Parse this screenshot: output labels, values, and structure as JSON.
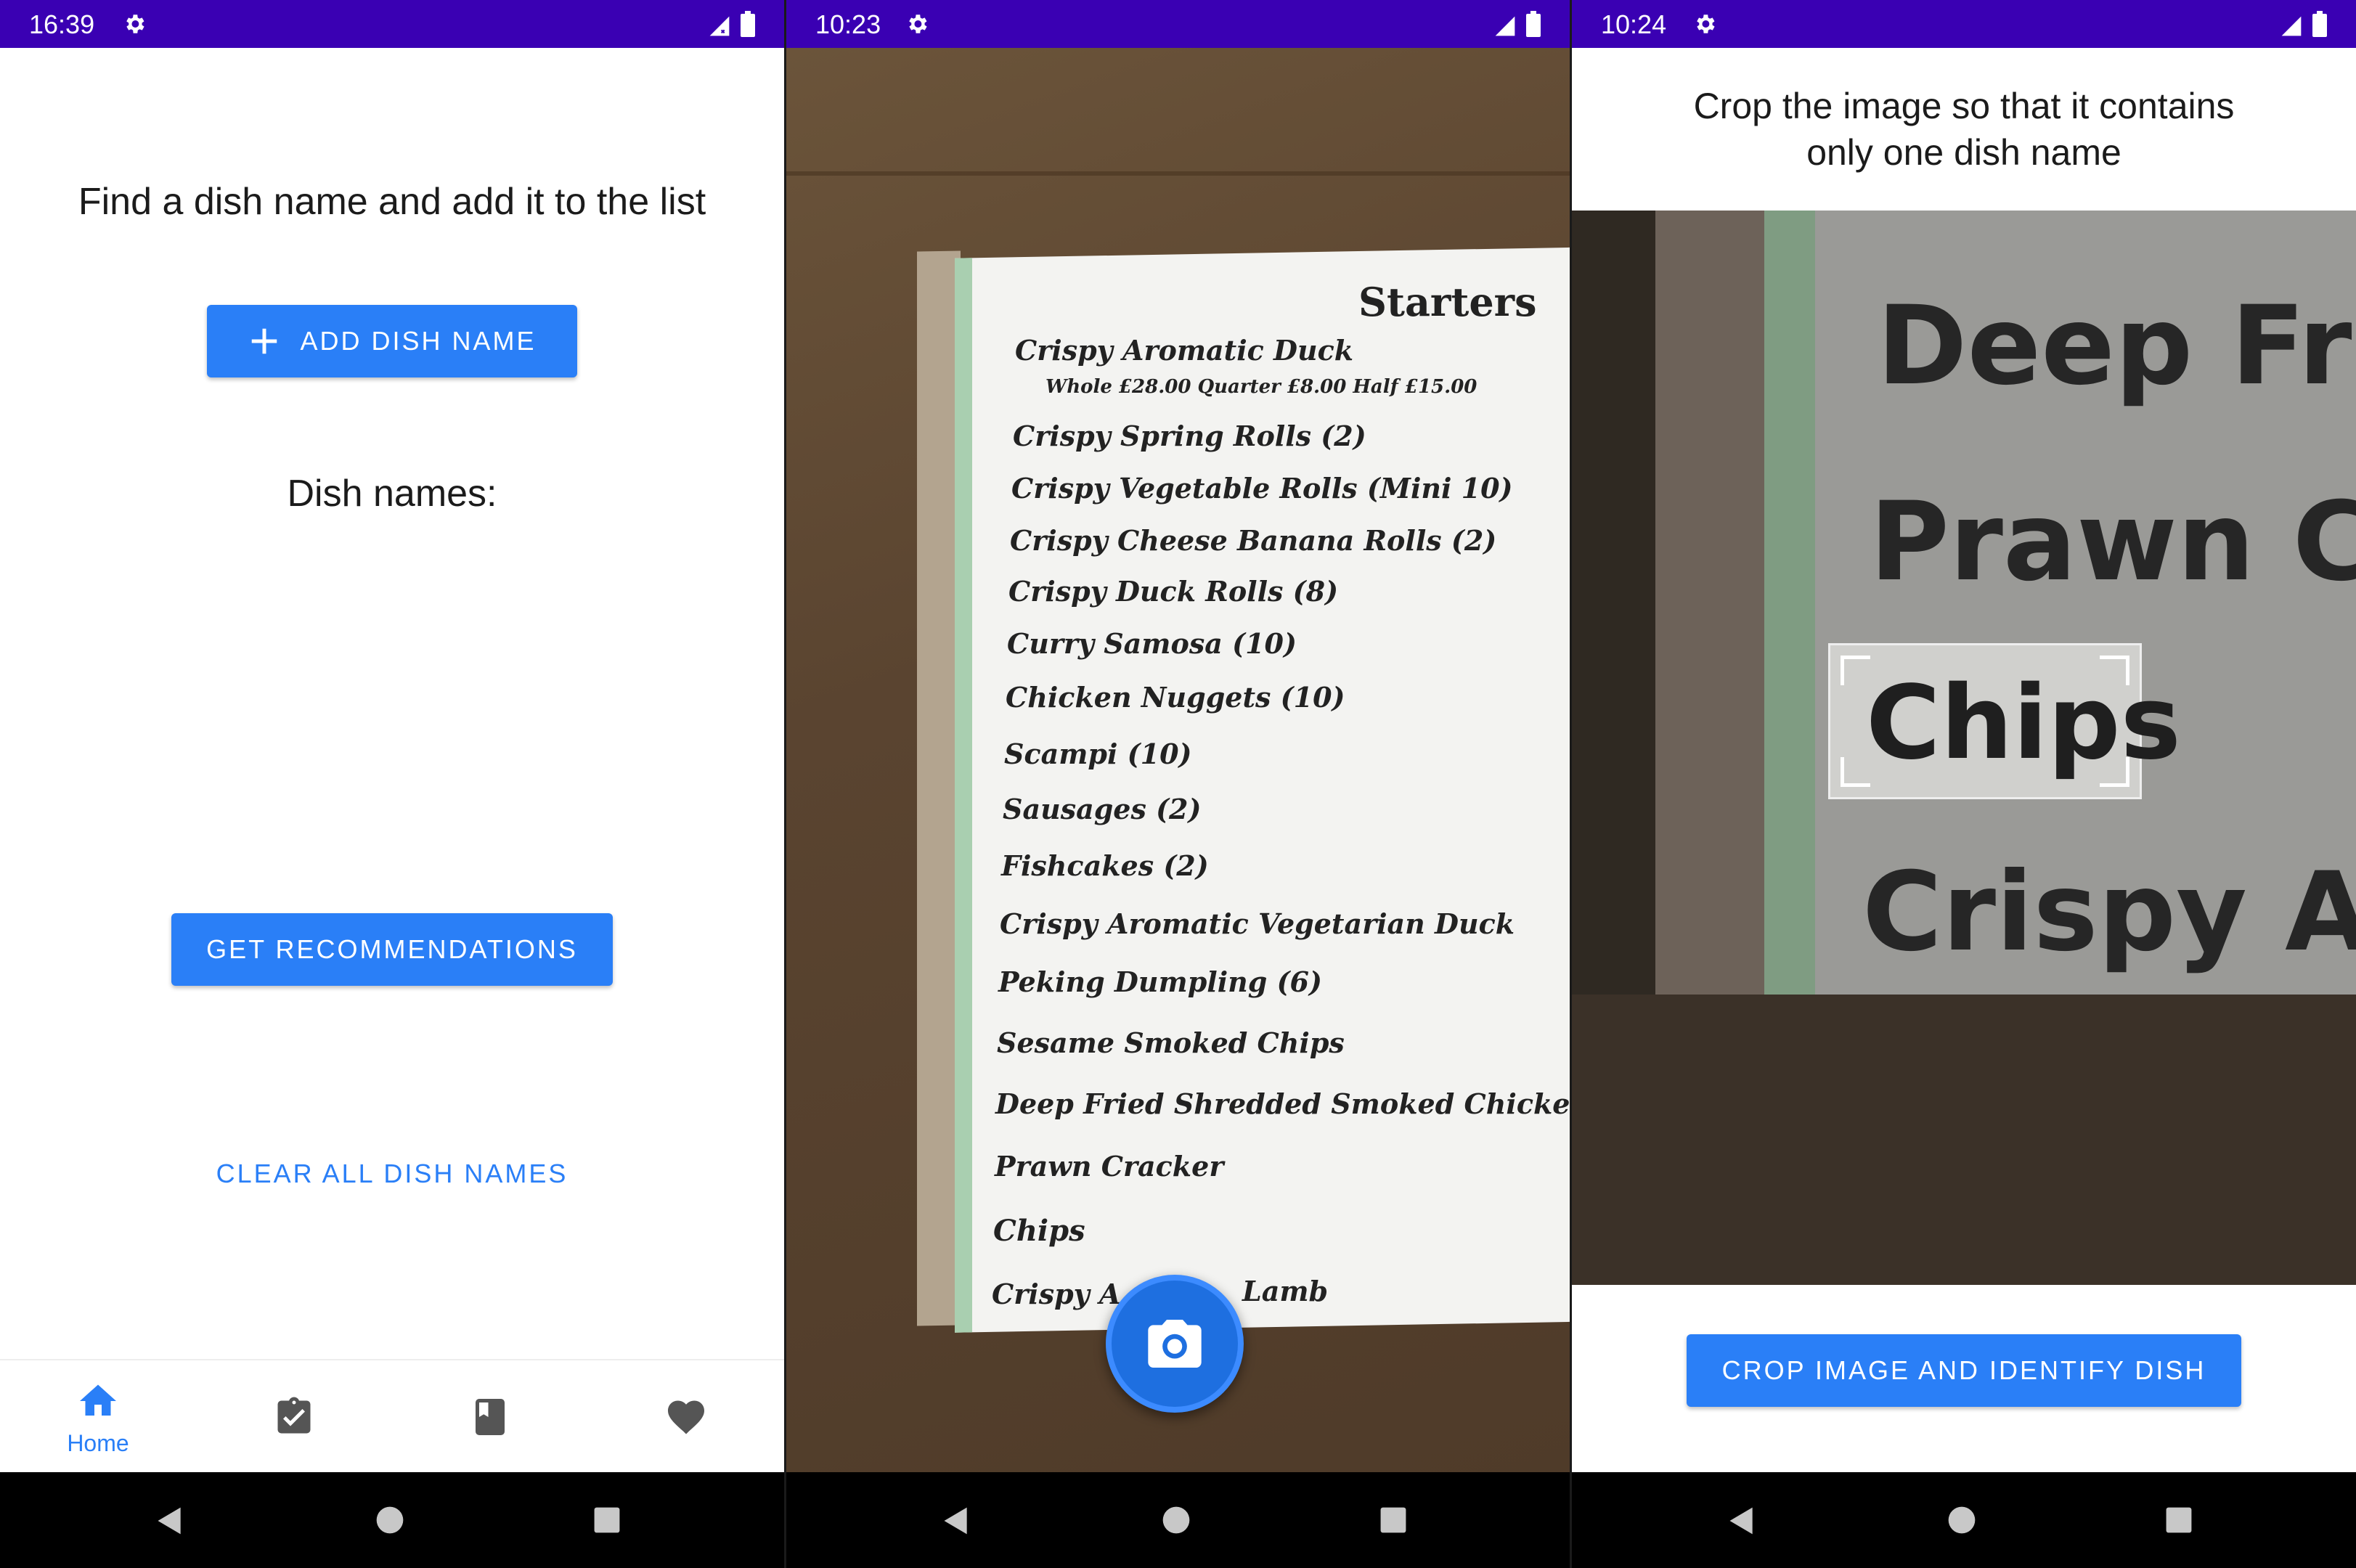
{
  "screens": [
    {
      "status": {
        "time": "16:39"
      },
      "title": "Find a dish name and add it to the list",
      "add_button": {
        "label": "ADD DISH NAME",
        "icon": "plus-icon"
      },
      "list_heading": "Dish names:",
      "recommend_button": "GET RECOMMENDATIONS",
      "clear_link": "CLEAR ALL DISH NAMES",
      "bottom_nav": [
        {
          "label": "Home",
          "icon": "home-icon",
          "active": true
        },
        {
          "label": "",
          "icon": "clipboard-check-icon",
          "active": false
        },
        {
          "label": "",
          "icon": "book-icon",
          "active": false
        },
        {
          "label": "",
          "icon": "heart-icon",
          "active": false
        }
      ]
    },
    {
      "status": {
        "time": "10:23"
      },
      "menu": {
        "heading": "Starters",
        "lines": [
          "Crispy Aromatic Duck",
          "Whole £28.00  Quarter £8.00  Half £15.00",
          "Crispy Spring Rolls (2)",
          "Crispy Vegetable Rolls (Mini 10)",
          "Crispy Cheese Banana Rolls (2)",
          "Crispy Duck Rolls (8)",
          "Curry Samosa (10)",
          "Chicken Nuggets (10)",
          "Scampi (10)",
          "Sausages (2)",
          "Fishcakes (2)",
          "Crispy Aromatic Vegetarian Duck",
          "Peking Dumpling (6)",
          "Sesame Smoked Chips",
          "Deep Fried Shredded Smoked Chicken",
          "Prawn Cracker",
          "Chips",
          "Crispy A",
          "Lamb"
        ]
      },
      "shutter_icon": "camera-icon"
    },
    {
      "status": {
        "time": "10:24"
      },
      "instruction": "Crop the image so that it contains only one dish name",
      "crop_lines": [
        "Deep Fried",
        "Prawn Crac",
        "Chips",
        "Crispy Aron"
      ],
      "crop_button": "CROP IMAGE AND IDENTIFY DISH"
    }
  ],
  "colors": {
    "status_bar": "#3a00b3",
    "accent": "#2a7ff7",
    "nav_bar": "#000000"
  }
}
